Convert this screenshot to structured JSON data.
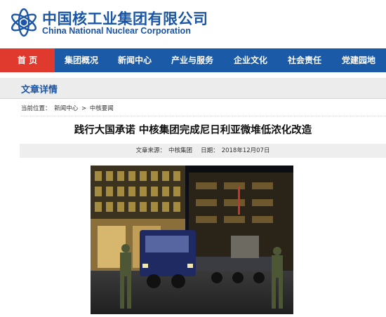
{
  "header": {
    "org_name_cn": "中国核工业集团有限公司",
    "org_name_en": "China National Nuclear Corporation",
    "logo_color": "#1a55a6"
  },
  "nav": {
    "color": "#1a5aa6",
    "active_color": "#e03a2e",
    "items": [
      {
        "label": "首 页",
        "active": true
      },
      {
        "label": "集团概况",
        "active": false
      },
      {
        "label": "新闻中心",
        "active": false
      },
      {
        "label": "产业与服务",
        "active": false
      },
      {
        "label": "企业文化",
        "active": false
      },
      {
        "label": "社会责任",
        "active": false
      },
      {
        "label": "党建园地",
        "active": false
      }
    ]
  },
  "section": {
    "title": "文章详情"
  },
  "breadcrumb": {
    "prefix": "当前位置：",
    "items": [
      "新闻中心",
      "中核要闻"
    ],
    "separator": ">"
  },
  "article": {
    "title": "践行大国承诺 中核集团完成尼日利亚微堆低浓化改造",
    "source_label": "文章来源：",
    "source": "中核集团",
    "date_label": "日期：",
    "date": "2018年12月07日"
  },
  "photo": {
    "alt_icon": "night-convoy-photo"
  }
}
